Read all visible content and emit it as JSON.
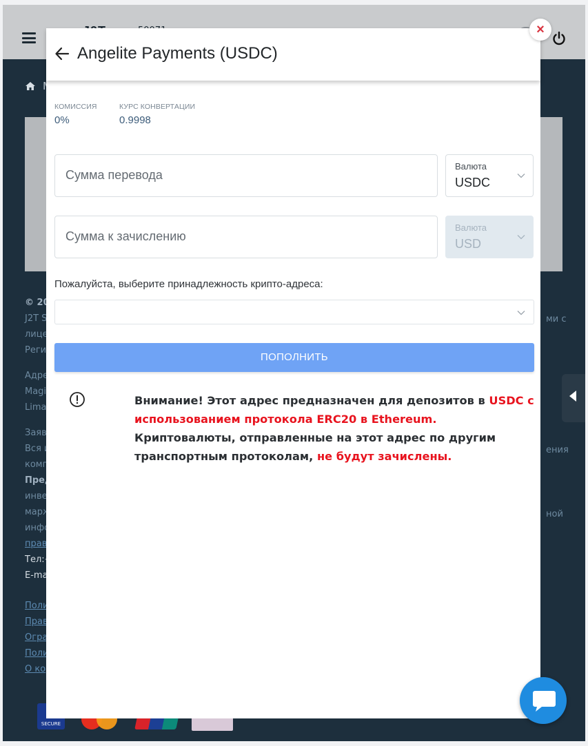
{
  "modal": {
    "title": "Angelite Payments (USDC)",
    "commission": {
      "label": "КОМИССИЯ",
      "value": "0%"
    },
    "rate": {
      "label": "КУРС КОНВЕРТАЦИИ",
      "value": "0.9998"
    },
    "amount_field": {
      "placeholder": "Сумма перевода",
      "value": ""
    },
    "amount_currency": {
      "label": "Валюта",
      "value": "USDC"
    },
    "credit_field": {
      "placeholder": "Сумма к зачислению",
      "value": ""
    },
    "credit_currency": {
      "label": "Валюта",
      "value": "USD",
      "disabled": true
    },
    "affiliation_label": "Пожалуйста, выберите принадлежность крипто-адреса:",
    "affiliation_value": "",
    "submit_label": "ПОПОЛНИТЬ",
    "warning": {
      "p1": "Внимание! Этот адрес предназначен для депозитов в ",
      "p2_red": "USDC с использованием протокола ERC20 в Ethereum.",
      "p3": " Криптовалюты, отправленные на этот адрес по другим транспортным протоколам, ",
      "p4_red": "не будут зачислены."
    },
    "close_symbol": "×"
  },
  "background": {
    "logo_peek": "J2T",
    "header_num_peek": "50071",
    "breadcrumb_peek": "M",
    "footer": {
      "copyright_peek": "© 20",
      "line1_peek": "J2T S",
      "line1_right_peek": "ми с",
      "line2_peek": "лице",
      "line3_peek": "Реги",
      "address1_peek": "Адре",
      "address2_peek": "Magi",
      "address3_peek": "Lima",
      "claim1_peek": "Заяв",
      "claim2_peek": "Вся и",
      "claim2_right_peek": "ения",
      "claim3_peek": "комп",
      "warn1_peek": "Пред",
      "warn2_peek": "инве",
      "warn3_peek": "марж",
      "warn3_right_peek": "ной",
      "warn4_peek": "инфо",
      "warn5_link_peek": "прав",
      "tel_peek": "Тел:+",
      "email_peek": "E-ma",
      "links": [
        "Поли",
        "Прав",
        "Огра",
        "Поли",
        "О ко"
      ]
    },
    "visa_small": "SECURE"
  }
}
